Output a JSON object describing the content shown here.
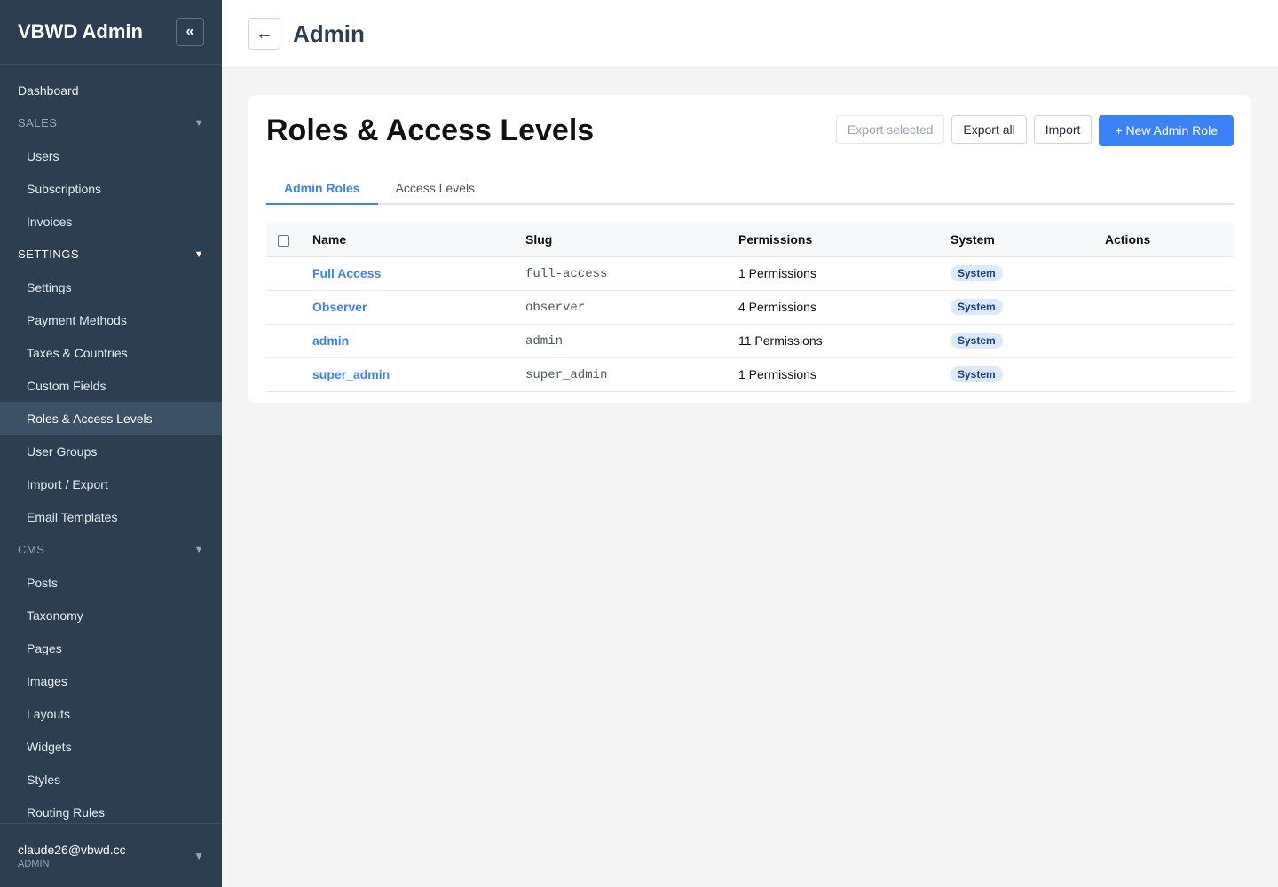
{
  "sidebar": {
    "brand": "VBWD Admin",
    "collapse_icon": "«",
    "dashboard": "Dashboard",
    "sections": [
      {
        "label": "SALES",
        "caret": "▼",
        "items": [
          "Users",
          "Subscriptions",
          "Invoices"
        ]
      },
      {
        "label": "SETTINGS",
        "caret": "▼",
        "items": [
          "Settings",
          "Payment Methods",
          "Taxes & Countries",
          "Custom Fields",
          "Roles & Access Levels",
          "User Groups",
          "Import / Export",
          "Email Templates"
        ]
      },
      {
        "label": "CMS",
        "caret": "▼",
        "items": [
          "Posts",
          "Taxonomy",
          "Pages",
          "Images",
          "Layouts",
          "Widgets",
          "Styles",
          "Routing Rules"
        ]
      }
    ],
    "active_item": "Roles & Access Levels",
    "user": {
      "email": "claude26@vbwd.cc",
      "role": "ADMIN",
      "caret": "▼"
    }
  },
  "topbar": {
    "back_icon": "←",
    "title": "Admin"
  },
  "main": {
    "title": "Roles & Access Levels",
    "buttons": {
      "export_selected": "Export selected",
      "export_all": "Export all",
      "import": "Import",
      "new_role": "+ New Admin Role"
    },
    "tabs": [
      {
        "label": "Admin Roles",
        "active": true
      },
      {
        "label": "Access Levels",
        "active": false
      }
    ],
    "table": {
      "headers": [
        "Name",
        "Slug",
        "Permissions",
        "System",
        "Actions"
      ],
      "rows": [
        {
          "name": "Full Access",
          "slug": "full-access",
          "permissions": "1 Permissions",
          "system": "System"
        },
        {
          "name": "Observer",
          "slug": "observer",
          "permissions": "4 Permissions",
          "system": "System"
        },
        {
          "name": "admin",
          "slug": "admin",
          "permissions": "11 Permissions",
          "system": "System"
        },
        {
          "name": "super_admin",
          "slug": "super_admin",
          "permissions": "1 Permissions",
          "system": "System"
        }
      ]
    }
  },
  "colors": {
    "sidebar_bg": "#2c3e50",
    "accent": "#3b82f6",
    "badge_bg": "#dbeafe"
  }
}
